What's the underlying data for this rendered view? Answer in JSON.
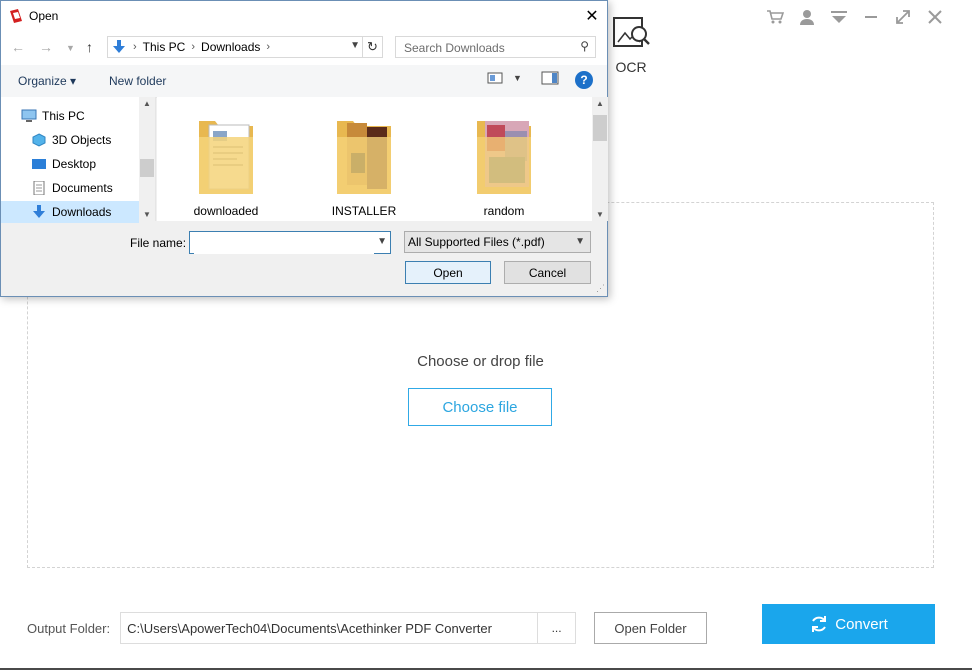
{
  "app": {
    "tool": {
      "label": "OCR"
    },
    "drop_text": "Choose or drop file",
    "choose_button": "Choose file",
    "output_label": "Output Folder:",
    "output_path": "C:\\Users\\ApowerTech04\\Documents\\Acethinker PDF Converter",
    "browse_label": "...",
    "open_folder": "Open Folder",
    "convert": "Convert",
    "accent_color": "#1aa6ec"
  },
  "dialog": {
    "title": "Open",
    "breadcrumb": [
      "This PC",
      "Downloads"
    ],
    "search_placeholder": "Search Downloads",
    "organize": "Organize ▾",
    "new_folder": "New folder",
    "help": "?",
    "nav_items": [
      {
        "label": "This PC",
        "icon": "computer-icon"
      },
      {
        "label": "3D Objects",
        "icon": "cube-icon"
      },
      {
        "label": "Desktop",
        "icon": "desktop-icon"
      },
      {
        "label": "Documents",
        "icon": "documents-icon"
      },
      {
        "label": "Downloads",
        "icon": "download-arrow-icon"
      }
    ],
    "folders": [
      {
        "label": "downloaded"
      },
      {
        "label": "INSTALLER"
      },
      {
        "label": "random"
      }
    ],
    "file_name_label": "File name:",
    "file_name_value": "",
    "filter": "All Supported Files (*.pdf)",
    "open_button": "Open",
    "cancel_button": "Cancel"
  }
}
